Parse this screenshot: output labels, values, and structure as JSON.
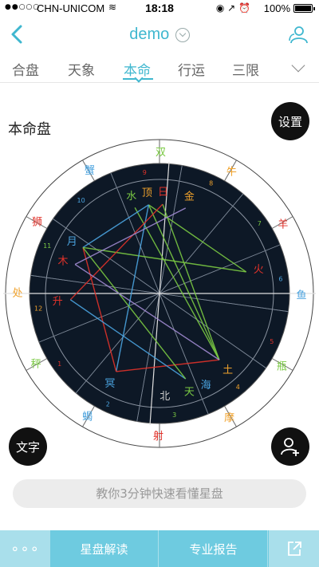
{
  "status_bar": {
    "signal": "●●○○○",
    "carrier": "CHN-UNICOM",
    "time": "18:18",
    "status_icons": "◉ ↗ ⏰",
    "battery": "100%"
  },
  "nav": {
    "title": "demo"
  },
  "tabs": [
    {
      "label": "合盘"
    },
    {
      "label": "天象"
    },
    {
      "label": "本命"
    },
    {
      "label": "行运"
    },
    {
      "label": "三限"
    }
  ],
  "active_tab": "本命",
  "page": {
    "chart_title": "本命盘",
    "settings_label": "设置",
    "text_label": "文字",
    "tip": "教你3分钟快速看懂星盘"
  },
  "bottom_bar": {
    "more_label": "∘∘∘",
    "reading_label": "星盘解读",
    "report_label": "专业报告"
  },
  "colors": {
    "accent": "#3fb7cf",
    "wheel_bg": "#0d1826",
    "fire": "#e0322a",
    "earth": "#f0a22c",
    "air": "#7ac943",
    "water": "#4aa3df"
  },
  "wheel": {
    "signs": [
      {
        "glyph": "双",
        "color": "#7ac943"
      },
      {
        "glyph": "牛",
        "color": "#f0a22c"
      },
      {
        "glyph": "羊",
        "color": "#e0322a"
      },
      {
        "glyph": "鱼",
        "color": "#4aa3df"
      },
      {
        "glyph": "瓶",
        "color": "#7ac943"
      },
      {
        "glyph": "摩",
        "color": "#f0a22c"
      },
      {
        "glyph": "射",
        "color": "#e0322a"
      },
      {
        "glyph": "蝎",
        "color": "#4aa3df"
      },
      {
        "glyph": "秤",
        "color": "#7ac943"
      },
      {
        "glyph": "处",
        "color": "#f0a22c"
      },
      {
        "glyph": "狮",
        "color": "#e0322a"
      },
      {
        "glyph": "蟹",
        "color": "#4aa3df"
      }
    ],
    "house_numbers": [
      "9",
      "8",
      "7",
      "6",
      "5",
      "4",
      "3",
      "2",
      "1",
      "12",
      "11",
      "10"
    ],
    "planets": [
      {
        "glyph": "水",
        "color": "#7ac943"
      },
      {
        "glyph": "顶",
        "color": "#f0a22c"
      },
      {
        "glyph": "日",
        "color": "#e0322a"
      },
      {
        "glyph": "金",
        "color": "#f0a22c"
      },
      {
        "glyph": "火",
        "color": "#e0322a"
      },
      {
        "glyph": "土",
        "color": "#f0a22c"
      },
      {
        "glyph": "海",
        "color": "#4aa3df"
      },
      {
        "glyph": "天",
        "color": "#7ac943"
      },
      {
        "glyph": "北",
        "color": "#cccccc"
      },
      {
        "glyph": "冥",
        "color": "#4aa3df"
      },
      {
        "glyph": "升",
        "color": "#e0322a"
      },
      {
        "glyph": "木",
        "color": "#e0322a"
      },
      {
        "glyph": "月",
        "color": "#4aa3df"
      }
    ]
  }
}
